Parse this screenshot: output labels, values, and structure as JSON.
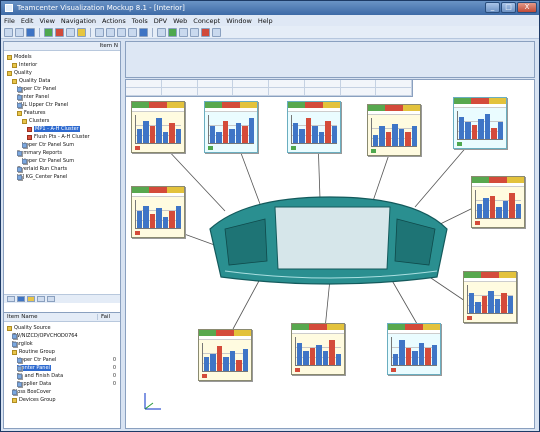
{
  "window": {
    "title": "Teamcenter Visualization Mockup 8.1 - [Interior]",
    "controls": [
      "_",
      "□",
      "X"
    ]
  },
  "menu": [
    "File",
    "Edit",
    "View",
    "Navigation",
    "Actions",
    "Tools",
    "DPV",
    "Web",
    "Concept",
    "Window",
    "Help"
  ],
  "colors": {
    "accent": "#3d6aa6",
    "selection": "#2f6bd0",
    "part": "#2a8f90",
    "status_green": "#58a84e",
    "status_red": "#d44b3a",
    "status_yellow": "#e3c23c"
  },
  "upper_panel": {
    "header_right": "Item N",
    "items": [
      {
        "label": "Models",
        "icon": "folder-icon"
      },
      {
        "label": "Interior",
        "icon": "folder-icon"
      },
      {
        "label": "Quality",
        "icon": "folder-icon"
      },
      {
        "label": "Quality Data",
        "icon": "folder-icon"
      },
      {
        "label": "Upper Ctr Panel",
        "icon": "report-icon"
      },
      {
        "label": "Center Panel",
        "icon": "report-icon"
      },
      {
        "label": "HUL Upper Ctr Panel",
        "icon": "report-icon"
      },
      {
        "label": "Features",
        "icon": "folder-icon"
      },
      {
        "label": "Clusters",
        "icon": "folder-icon"
      },
      {
        "label": "MP1 - A-H Cluster",
        "icon": "chart-icon",
        "selected": true
      },
      {
        "label": "Flush Pts - A-H Cluster",
        "icon": "chart-icon"
      },
      {
        "label": "Upper Ctr Panel Sum",
        "icon": "report-icon"
      },
      {
        "label": "Summary Reports",
        "icon": "report-icon"
      },
      {
        "label": "Upper Ctr Panel Sum",
        "icon": "report-icon"
      },
      {
        "label": "Overlaid Run Charts",
        "icon": "report-icon"
      },
      {
        "label": "[2] KG_Center Panel",
        "icon": "report-icon"
      }
    ]
  },
  "lower_panel": {
    "columns": [
      "Item Name",
      "Fail"
    ],
    "items": [
      {
        "label": "Quality Source",
        "icon": "folder-icon",
        "value": ""
      },
      {
        "label": "7W/NIZCD/OPVCHOD0764",
        "icon": "report-icon",
        "value": ""
      },
      {
        "label": "Nargilok",
        "icon": "report-icon",
        "value": ""
      },
      {
        "label": "Routine Group",
        "icon": "folder-icon",
        "value": ""
      },
      {
        "label": "Upper Ctr Panel",
        "icon": "report-icon",
        "value": "0"
      },
      {
        "label": "Center Panel",
        "icon": "report-icon",
        "value": "0",
        "selected": true
      },
      {
        "label": "Fit and Finish Data",
        "icon": "report-icon",
        "value": "0"
      },
      {
        "label": "Supplier Data",
        "icon": "report-icon",
        "value": "0"
      },
      {
        "label": "Gloss BoxCover",
        "icon": "report-icon",
        "value": ""
      },
      {
        "label": "Devices Group",
        "icon": "folder-icon",
        "value": ""
      }
    ]
  },
  "reports": [
    {
      "style": "yellow",
      "heights": [
        0.5,
        0.8,
        0.6,
        0.9,
        0.4,
        0.7,
        0.5
      ],
      "status": "red"
    },
    {
      "style": "cyan",
      "heights": [
        0.6,
        0.4,
        0.8,
        0.5,
        0.7,
        0.6,
        0.9
      ],
      "status": "green"
    },
    {
      "style": "cyan",
      "heights": [
        0.7,
        0.5,
        0.9,
        0.6,
        0.4,
        0.8,
        0.6
      ],
      "status": "green"
    },
    {
      "style": "yellow",
      "heights": [
        0.4,
        0.7,
        0.5,
        0.8,
        0.6,
        0.5,
        0.7
      ],
      "status": "green"
    },
    {
      "style": "cyan",
      "heights": [
        0.8,
        0.6,
        0.5,
        0.7,
        0.9,
        0.4,
        0.6
      ],
      "status": "green"
    },
    {
      "style": "yellow",
      "heights": [
        0.5,
        0.7,
        0.8,
        0.4,
        0.6,
        0.9,
        0.5
      ],
      "status": "red"
    },
    {
      "style": "yellow",
      "heights": [
        0.6,
        0.8,
        0.5,
        0.7,
        0.4,
        0.6,
        0.8
      ],
      "status": "red"
    },
    {
      "style": "yellow",
      "heights": [
        0.7,
        0.4,
        0.6,
        0.8,
        0.5,
        0.7,
        0.6
      ],
      "status": "red"
    },
    {
      "style": "yellow",
      "heights": [
        0.5,
        0.6,
        0.9,
        0.5,
        0.7,
        0.4,
        0.8
      ],
      "status": "red"
    },
    {
      "style": "yellow",
      "heights": [
        0.8,
        0.5,
        0.6,
        0.7,
        0.5,
        0.9,
        0.4
      ],
      "status": "red"
    },
    {
      "style": "cyan",
      "heights": [
        0.4,
        0.9,
        0.6,
        0.5,
        0.8,
        0.6,
        0.7
      ],
      "status": "red"
    }
  ]
}
